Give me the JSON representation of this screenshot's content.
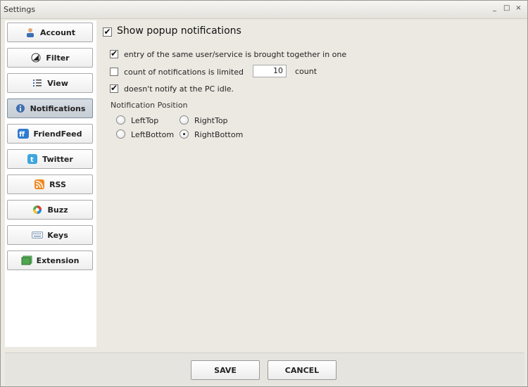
{
  "window": {
    "title": "Settings",
    "controls": [
      "_",
      "□",
      "×"
    ]
  },
  "sidebar": {
    "items": [
      {
        "label": "Account",
        "icon": "user-icon"
      },
      {
        "label": "Filter",
        "icon": "filter-icon"
      },
      {
        "label": "View",
        "icon": "list-view-icon"
      },
      {
        "label": "Notifications",
        "icon": "info-icon",
        "active": true
      },
      {
        "label": "FriendFeed",
        "icon": "friendfeed-icon"
      },
      {
        "label": "Twitter",
        "icon": "twitter-icon"
      },
      {
        "label": "RSS",
        "icon": "rss-icon"
      },
      {
        "label": "Buzz",
        "icon": "buzz-icon"
      },
      {
        "label": "Keys",
        "icon": "keyboard-icon"
      },
      {
        "label": "Extension",
        "icon": "extension-icon"
      }
    ]
  },
  "notifications": {
    "show_popup_label": "Show popup notifications",
    "show_popup_checked": true,
    "merge_label": "entry of the same user/service is brought together in one",
    "merge_checked": true,
    "limit_label": "count of notifications is limited",
    "limit_checked": false,
    "limit_value": "10",
    "limit_unit": "count",
    "idle_label": "doesn't notify at the PC idle.",
    "idle_checked": true,
    "position_label": "Notification Position",
    "positions": [
      {
        "label": "LeftTop",
        "selected": false
      },
      {
        "label": "RightTop",
        "selected": false
      },
      {
        "label": "LeftBottom",
        "selected": false
      },
      {
        "label": "RightBottom",
        "selected": true
      }
    ]
  },
  "footer": {
    "save_label": "SAVE",
    "cancel_label": "CANCEL"
  },
  "colors": {
    "window_bg": "#ece9e2",
    "active_nav_bg": "#c7cdd4",
    "sidebar_bg": "#ffffff"
  }
}
